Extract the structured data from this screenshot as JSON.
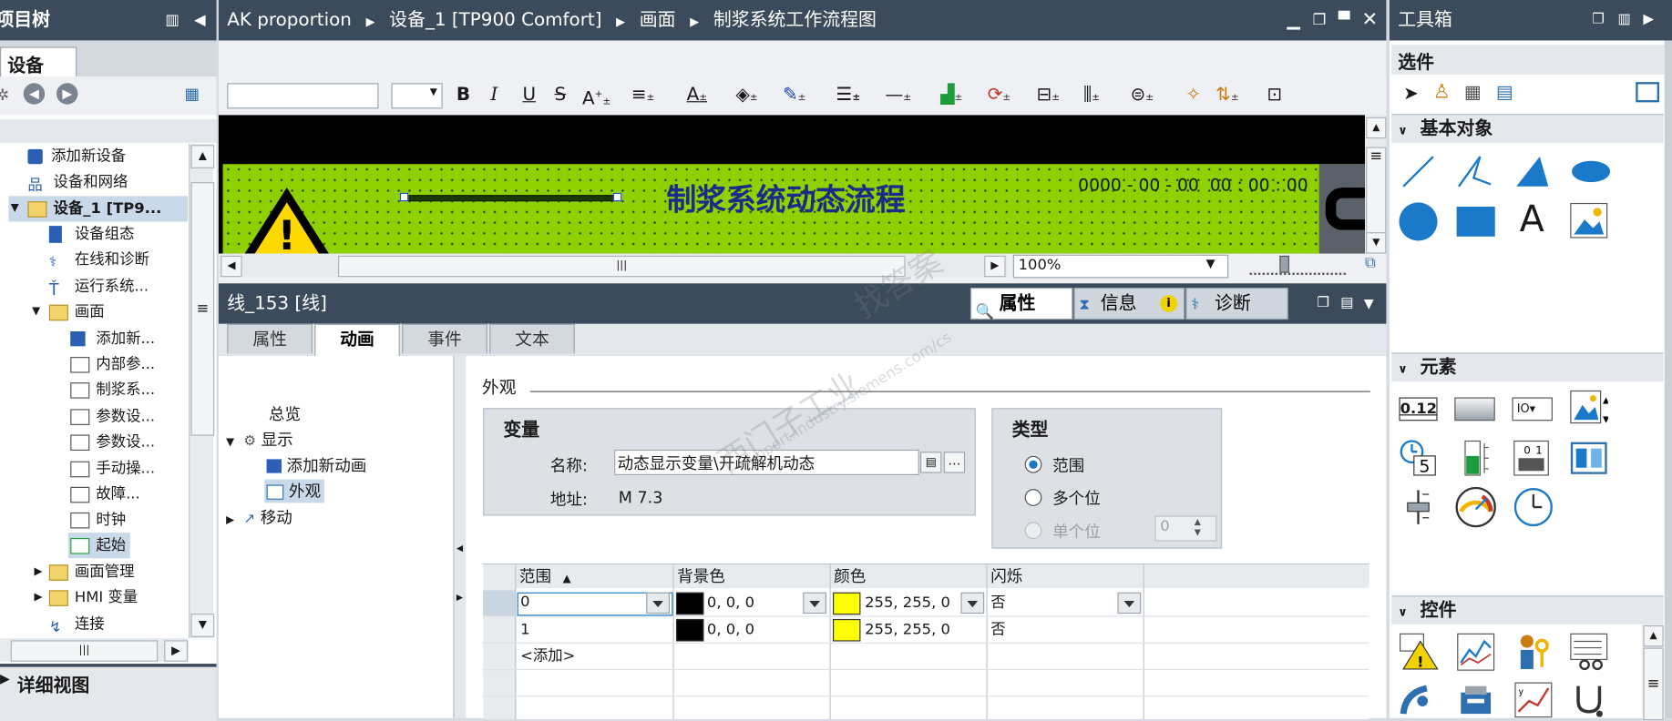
{
  "project_tree": {
    "title": "项目树",
    "tab": "设备",
    "items": [
      {
        "label": "添加新设备"
      },
      {
        "label": "设备和网络"
      },
      {
        "label": "设备_1 [TP9..."
      },
      {
        "label": "设备组态"
      },
      {
        "label": "在线和诊断"
      },
      {
        "label": "运行系统..."
      },
      {
        "label": "画面"
      },
      {
        "label": "添加新..."
      },
      {
        "label": "内部参..."
      },
      {
        "label": "制浆系..."
      },
      {
        "label": "参数设..."
      },
      {
        "label": "参数设..."
      },
      {
        "label": "手动操..."
      },
      {
        "label": "故障..."
      },
      {
        "label": "时钟"
      },
      {
        "label": "起始"
      },
      {
        "label": "画面管理"
      },
      {
        "label": "HMI 变量"
      },
      {
        "label": "连接"
      }
    ],
    "detail_view": "详细视图"
  },
  "breadcrumb": [
    "AK proportion",
    "设备_1 [TP900 Comfort]",
    "画面",
    "制浆系统工作流程图"
  ],
  "screen": {
    "title": "制浆系统动态流程",
    "datetime": "0000 - 00 - 00  00 : 00 : 00",
    "zoom": "100%"
  },
  "inspector": {
    "object_title": "线_153 [线]",
    "right_tabs": [
      "属性",
      "信息",
      "诊断"
    ],
    "tabs": [
      "属性",
      "动画",
      "事件",
      "文本"
    ],
    "nav": {
      "overview": "总览",
      "display": "显示",
      "add_animation": "添加新动画",
      "appearance": "外观",
      "movement": "移动"
    },
    "section_title": "外观",
    "variable": {
      "heading": "变量",
      "name_label": "名称:",
      "name_value": "动态显示变量\\开疏解机动态",
      "address_label": "地址:",
      "address_value": "M 7.3"
    },
    "type": {
      "heading": "类型",
      "options": [
        "范围",
        "多个位",
        "单个位"
      ],
      "selected": "范围",
      "bit_value": "0"
    },
    "table": {
      "columns": [
        "范围",
        "背景色",
        "颜色",
        "闪烁"
      ],
      "rows": [
        {
          "range": "0",
          "bg": "0, 0, 0",
          "color": "255, 255, 0",
          "blink": "否"
        },
        {
          "range": "1",
          "bg": "0, 0, 0",
          "color": "255, 255, 0",
          "blink": "否"
        }
      ],
      "add_label": "<添加>"
    }
  },
  "toolbox": {
    "title": "工具箱",
    "options": "选件",
    "sections": [
      "基本对象",
      "元素",
      "控件"
    ],
    "element_text_a": "A",
    "element_text_value": "0.12"
  },
  "watermark": [
    "西门子工业",
    "找答案",
    "support.industry.siemens.com/cs"
  ],
  "colors": {
    "pane_title": "#3b4b5b",
    "screen_green": "#8fd000",
    "accent_yellow": "#ffff00",
    "accent_blue": "#1a7ac9"
  }
}
